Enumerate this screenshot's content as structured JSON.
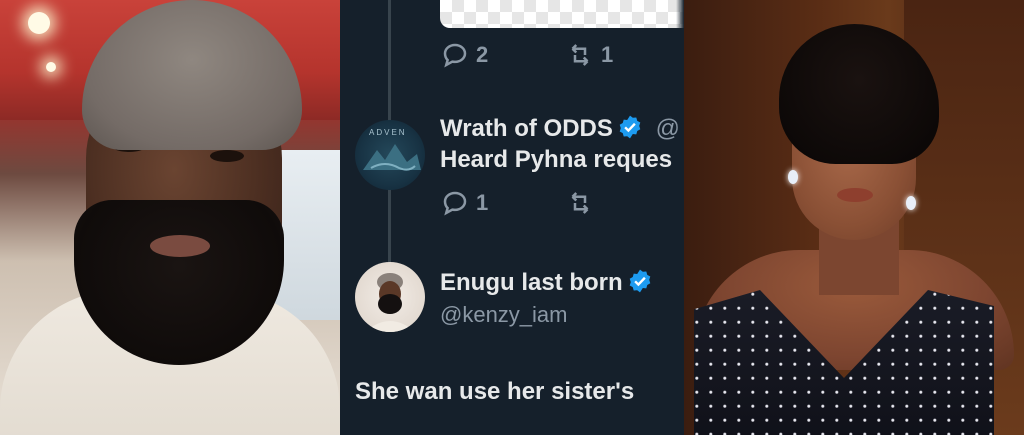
{
  "left_photo": {
    "alt": "man-with-beanie-and-beard"
  },
  "tweet_panel": {
    "top_post": {
      "reply_count": "2",
      "retweet_count": "1"
    },
    "reply_1": {
      "avatar_text": "ADVEN",
      "display_name": "Wrath of ODDS",
      "handle_fragment": "@",
      "text": "Heard Pyhna reques",
      "reply_count": "1",
      "retweet_count": ""
    },
    "reply_2": {
      "display_name": "Enugu last born",
      "handle": "@kenzy_iam",
      "text": "She wan use her sister's"
    },
    "colors": {
      "background": "#15202b",
      "text": "#e7e9ea",
      "muted": "#8b98a5",
      "verified": "#1d9bf0"
    }
  },
  "right_photo": {
    "alt": "woman-in-sequin-dress"
  }
}
